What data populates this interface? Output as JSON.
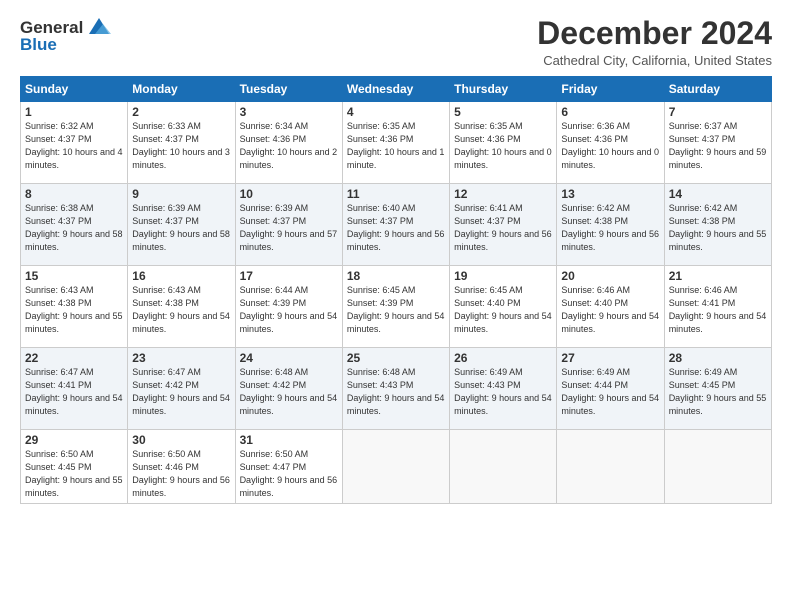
{
  "header": {
    "logo_line1": "General",
    "logo_line2": "Blue",
    "title": "December 2024",
    "location": "Cathedral City, California, United States"
  },
  "days_of_week": [
    "Sunday",
    "Monday",
    "Tuesday",
    "Wednesday",
    "Thursday",
    "Friday",
    "Saturday"
  ],
  "weeks": [
    [
      {
        "day": "1",
        "sunrise": "6:32 AM",
        "sunset": "4:37 PM",
        "daylight": "10 hours and 4 minutes."
      },
      {
        "day": "2",
        "sunrise": "6:33 AM",
        "sunset": "4:37 PM",
        "daylight": "10 hours and 3 minutes."
      },
      {
        "day": "3",
        "sunrise": "6:34 AM",
        "sunset": "4:36 PM",
        "daylight": "10 hours and 2 minutes."
      },
      {
        "day": "4",
        "sunrise": "6:35 AM",
        "sunset": "4:36 PM",
        "daylight": "10 hours and 1 minute."
      },
      {
        "day": "5",
        "sunrise": "6:35 AM",
        "sunset": "4:36 PM",
        "daylight": "10 hours and 0 minutes."
      },
      {
        "day": "6",
        "sunrise": "6:36 AM",
        "sunset": "4:36 PM",
        "daylight": "10 hours and 0 minutes."
      },
      {
        "day": "7",
        "sunrise": "6:37 AM",
        "sunset": "4:37 PM",
        "daylight": "9 hours and 59 minutes."
      }
    ],
    [
      {
        "day": "8",
        "sunrise": "6:38 AM",
        "sunset": "4:37 PM",
        "daylight": "9 hours and 58 minutes."
      },
      {
        "day": "9",
        "sunrise": "6:39 AM",
        "sunset": "4:37 PM",
        "daylight": "9 hours and 58 minutes."
      },
      {
        "day": "10",
        "sunrise": "6:39 AM",
        "sunset": "4:37 PM",
        "daylight": "9 hours and 57 minutes."
      },
      {
        "day": "11",
        "sunrise": "6:40 AM",
        "sunset": "4:37 PM",
        "daylight": "9 hours and 56 minutes."
      },
      {
        "day": "12",
        "sunrise": "6:41 AM",
        "sunset": "4:37 PM",
        "daylight": "9 hours and 56 minutes."
      },
      {
        "day": "13",
        "sunrise": "6:42 AM",
        "sunset": "4:38 PM",
        "daylight": "9 hours and 56 minutes."
      },
      {
        "day": "14",
        "sunrise": "6:42 AM",
        "sunset": "4:38 PM",
        "daylight": "9 hours and 55 minutes."
      }
    ],
    [
      {
        "day": "15",
        "sunrise": "6:43 AM",
        "sunset": "4:38 PM",
        "daylight": "9 hours and 55 minutes."
      },
      {
        "day": "16",
        "sunrise": "6:43 AM",
        "sunset": "4:38 PM",
        "daylight": "9 hours and 54 minutes."
      },
      {
        "day": "17",
        "sunrise": "6:44 AM",
        "sunset": "4:39 PM",
        "daylight": "9 hours and 54 minutes."
      },
      {
        "day": "18",
        "sunrise": "6:45 AM",
        "sunset": "4:39 PM",
        "daylight": "9 hours and 54 minutes."
      },
      {
        "day": "19",
        "sunrise": "6:45 AM",
        "sunset": "4:40 PM",
        "daylight": "9 hours and 54 minutes."
      },
      {
        "day": "20",
        "sunrise": "6:46 AM",
        "sunset": "4:40 PM",
        "daylight": "9 hours and 54 minutes."
      },
      {
        "day": "21",
        "sunrise": "6:46 AM",
        "sunset": "4:41 PM",
        "daylight": "9 hours and 54 minutes."
      }
    ],
    [
      {
        "day": "22",
        "sunrise": "6:47 AM",
        "sunset": "4:41 PM",
        "daylight": "9 hours and 54 minutes."
      },
      {
        "day": "23",
        "sunrise": "6:47 AM",
        "sunset": "4:42 PM",
        "daylight": "9 hours and 54 minutes."
      },
      {
        "day": "24",
        "sunrise": "6:48 AM",
        "sunset": "4:42 PM",
        "daylight": "9 hours and 54 minutes."
      },
      {
        "day": "25",
        "sunrise": "6:48 AM",
        "sunset": "4:43 PM",
        "daylight": "9 hours and 54 minutes."
      },
      {
        "day": "26",
        "sunrise": "6:49 AM",
        "sunset": "4:43 PM",
        "daylight": "9 hours and 54 minutes."
      },
      {
        "day": "27",
        "sunrise": "6:49 AM",
        "sunset": "4:44 PM",
        "daylight": "9 hours and 54 minutes."
      },
      {
        "day": "28",
        "sunrise": "6:49 AM",
        "sunset": "4:45 PM",
        "daylight": "9 hours and 55 minutes."
      }
    ],
    [
      {
        "day": "29",
        "sunrise": "6:50 AM",
        "sunset": "4:45 PM",
        "daylight": "9 hours and 55 minutes."
      },
      {
        "day": "30",
        "sunrise": "6:50 AM",
        "sunset": "4:46 PM",
        "daylight": "9 hours and 56 minutes."
      },
      {
        "day": "31",
        "sunrise": "6:50 AM",
        "sunset": "4:47 PM",
        "daylight": "9 hours and 56 minutes."
      },
      null,
      null,
      null,
      null
    ]
  ]
}
